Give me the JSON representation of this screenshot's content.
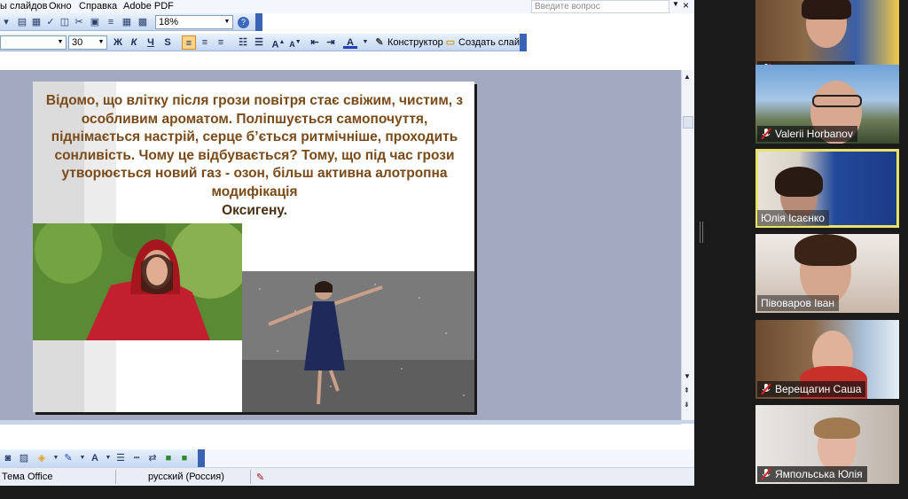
{
  "menu": {
    "items": [
      "ы слайдов",
      "Окно",
      "Справка",
      "Adobe PDF"
    ],
    "help_placeholder": "Введите вопрос",
    "close": "×"
  },
  "toolbar1": {
    "zoom": "18%"
  },
  "toolbar2": {
    "font_size": "30",
    "bold": "Ж",
    "italic": "К",
    "underline": "Ч",
    "shadow": "S",
    "designer_label": "Конструктор",
    "new_slide_label": "Создать слайд"
  },
  "slide": {
    "text": "Відомо, що влітку після грози повітря стає свіжим, чистим, з особливим ароматом. Поліпшується самопочуття, піднімається настрій, серце б’ється ритмічніше, проходить сонливість. Чому це відбувається? Тому, що під час грози утворюється новий газ - озон, більш активна алотропна модифікація",
    "last_line": "Оксигену."
  },
  "status": {
    "theme": "Тема Office",
    "language": "русский (Россия)"
  },
  "participants": [
    {
      "name": "Наталія Котова",
      "muted": true
    },
    {
      "name": "Valerii Horbanov",
      "muted": true
    },
    {
      "name": "Юлія Ісаєнко",
      "muted": false,
      "active": true
    },
    {
      "name": "Півоваров Іван",
      "muted": false
    },
    {
      "name": "Верещагин Саша",
      "muted": true
    },
    {
      "name": "Ямпольська Юлія",
      "muted": true
    }
  ],
  "colors": {
    "slide_text": "#7a4a18",
    "active_speaker": "#e8e26a",
    "mute_icon": "#e02020"
  }
}
